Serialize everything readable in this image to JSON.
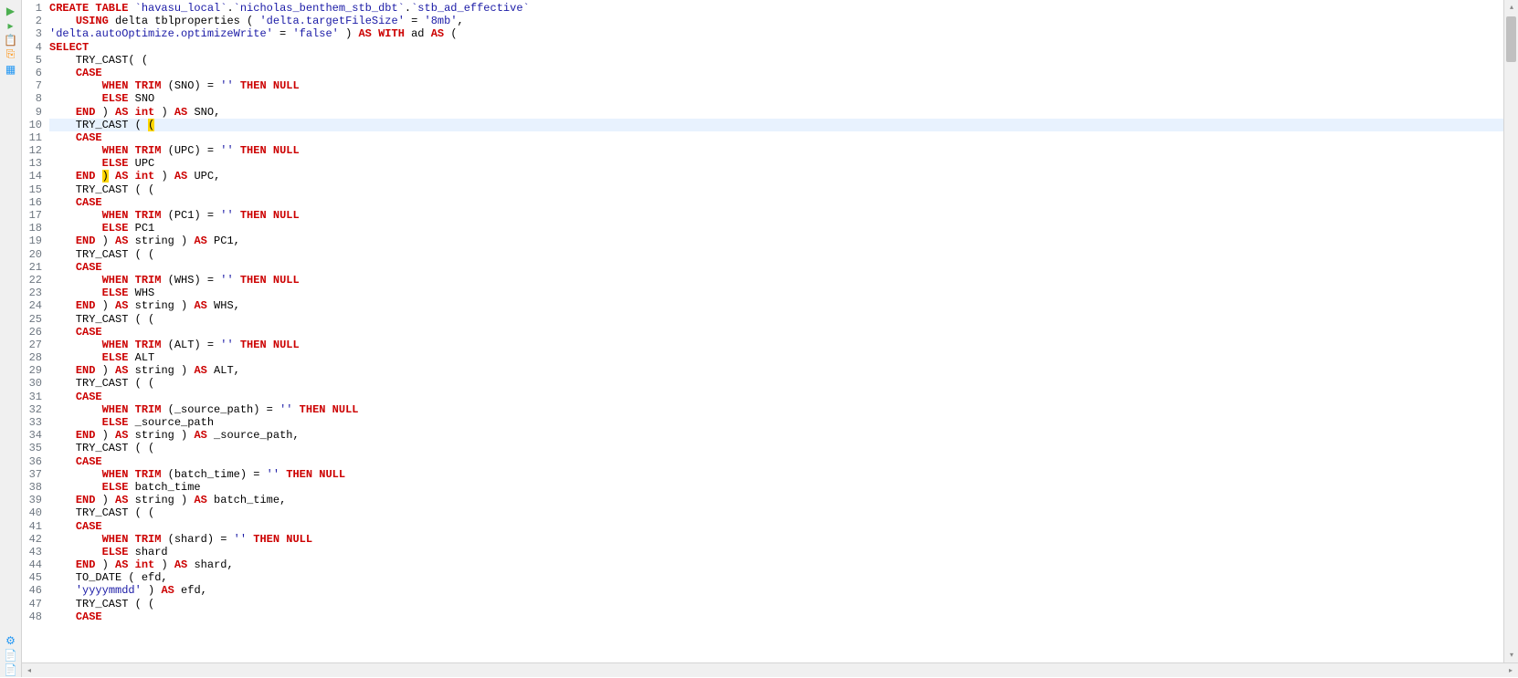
{
  "toolbar": {
    "icons": [
      {
        "name": "run-icon",
        "color": "#4CAF50",
        "glyph": "▶"
      },
      {
        "name": "run-cursor-icon",
        "color": "#4CAF50",
        "glyph": "▸"
      },
      {
        "name": "clipboard-icon",
        "color": "#ff8c00",
        "glyph": "📋"
      },
      {
        "name": "copy-icon",
        "color": "#ff8c00",
        "glyph": "⎘"
      },
      {
        "name": "doc-icon",
        "color": "#2196F3",
        "glyph": "▦"
      }
    ],
    "bottom_icons": [
      {
        "name": "settings-icon",
        "color": "#2196F3",
        "glyph": "⚙"
      },
      {
        "name": "new-doc-icon",
        "color": "#2196F3",
        "glyph": "📄"
      },
      {
        "name": "error-doc-icon",
        "color": "#f44336",
        "glyph": "📄"
      }
    ]
  },
  "code": {
    "lines": [
      {
        "n": 1,
        "tokens": [
          {
            "t": "CREATE TABLE",
            "c": "kw-red"
          },
          {
            "t": " "
          },
          {
            "t": "`havasu_local`",
            "c": "str"
          },
          {
            "t": "."
          },
          {
            "t": "`nicholas_benthem_stb_dbt`",
            "c": "str"
          },
          {
            "t": "."
          },
          {
            "t": "`stb_ad_effective`",
            "c": "str"
          }
        ]
      },
      {
        "n": 2,
        "indent": "    ",
        "tokens": [
          {
            "t": "USING",
            "c": "kw-red"
          },
          {
            "t": " delta tblproperties ( "
          },
          {
            "t": "'delta.targetFileSize'",
            "c": "str"
          },
          {
            "t": " = "
          },
          {
            "t": "'8mb'",
            "c": "str"
          },
          {
            "t": ","
          }
        ]
      },
      {
        "n": 3,
        "tokens": [
          {
            "t": "'delta.autoOptimize.optimizeWrite'",
            "c": "str"
          },
          {
            "t": " = "
          },
          {
            "t": "'false'",
            "c": "str"
          },
          {
            "t": " ) "
          },
          {
            "t": "AS WITH",
            "c": "kw-red"
          },
          {
            "t": " ad "
          },
          {
            "t": "AS",
            "c": "kw-red"
          },
          {
            "t": " ("
          }
        ]
      },
      {
        "n": 4,
        "tokens": [
          {
            "t": "SELECT",
            "c": "kw-red"
          }
        ]
      },
      {
        "n": 5,
        "indent": "    ",
        "tokens": [
          {
            "t": "TRY_CAST( ("
          }
        ]
      },
      {
        "n": 6,
        "indent": "    ",
        "tokens": [
          {
            "t": "CASE",
            "c": "kw-red"
          }
        ]
      },
      {
        "n": 7,
        "indent": "        ",
        "tokens": [
          {
            "t": "WHEN",
            "c": "kw-red"
          },
          {
            "t": " "
          },
          {
            "t": "TRIM",
            "c": "kw-red"
          },
          {
            "t": " (SNO) = "
          },
          {
            "t": "''",
            "c": "str"
          },
          {
            "t": " "
          },
          {
            "t": "THEN NULL",
            "c": "kw-red"
          }
        ]
      },
      {
        "n": 8,
        "indent": "        ",
        "tokens": [
          {
            "t": "ELSE",
            "c": "kw-red"
          },
          {
            "t": " SNO"
          }
        ]
      },
      {
        "n": 9,
        "indent": "    ",
        "tokens": [
          {
            "t": "END",
            "c": "kw-red"
          },
          {
            "t": " ) "
          },
          {
            "t": "AS",
            "c": "kw-red"
          },
          {
            "t": " "
          },
          {
            "t": "int",
            "c": "kw-red"
          },
          {
            "t": " ) "
          },
          {
            "t": "AS",
            "c": "kw-red"
          },
          {
            "t": " SNO,"
          }
        ]
      },
      {
        "n": 10,
        "hl": true,
        "indent": "    ",
        "tokens": [
          {
            "t": "TRY_CAST ( "
          },
          {
            "t": "(",
            "c": "paren-match"
          }
        ]
      },
      {
        "n": 11,
        "indent": "    ",
        "tokens": [
          {
            "t": "CASE",
            "c": "kw-red"
          }
        ]
      },
      {
        "n": 12,
        "indent": "        ",
        "tokens": [
          {
            "t": "WHEN",
            "c": "kw-red"
          },
          {
            "t": " "
          },
          {
            "t": "TRIM",
            "c": "kw-red"
          },
          {
            "t": " (UPC) = "
          },
          {
            "t": "''",
            "c": "str"
          },
          {
            "t": " "
          },
          {
            "t": "THEN NULL",
            "c": "kw-red"
          }
        ]
      },
      {
        "n": 13,
        "indent": "        ",
        "tokens": [
          {
            "t": "ELSE",
            "c": "kw-red"
          },
          {
            "t": " UPC"
          }
        ]
      },
      {
        "n": 14,
        "indent": "    ",
        "tokens": [
          {
            "t": "END",
            "c": "kw-red"
          },
          {
            "t": " "
          },
          {
            "t": ")",
            "c": "paren-match"
          },
          {
            "t": " "
          },
          {
            "t": "AS",
            "c": "kw-red"
          },
          {
            "t": " "
          },
          {
            "t": "int",
            "c": "kw-red"
          },
          {
            "t": " ) "
          },
          {
            "t": "AS",
            "c": "kw-red"
          },
          {
            "t": " UPC,"
          }
        ]
      },
      {
        "n": 15,
        "indent": "    ",
        "tokens": [
          {
            "t": "TRY_CAST ( ("
          }
        ]
      },
      {
        "n": 16,
        "indent": "    ",
        "tokens": [
          {
            "t": "CASE",
            "c": "kw-red"
          }
        ]
      },
      {
        "n": 17,
        "indent": "        ",
        "tokens": [
          {
            "t": "WHEN",
            "c": "kw-red"
          },
          {
            "t": " "
          },
          {
            "t": "TRIM",
            "c": "kw-red"
          },
          {
            "t": " (PC1) = "
          },
          {
            "t": "''",
            "c": "str"
          },
          {
            "t": " "
          },
          {
            "t": "THEN NULL",
            "c": "kw-red"
          }
        ]
      },
      {
        "n": 18,
        "indent": "        ",
        "tokens": [
          {
            "t": "ELSE",
            "c": "kw-red"
          },
          {
            "t": " PC1"
          }
        ]
      },
      {
        "n": 19,
        "indent": "    ",
        "tokens": [
          {
            "t": "END",
            "c": "kw-red"
          },
          {
            "t": " ) "
          },
          {
            "t": "AS",
            "c": "kw-red"
          },
          {
            "t": " string ) "
          },
          {
            "t": "AS",
            "c": "kw-red"
          },
          {
            "t": " PC1,"
          }
        ]
      },
      {
        "n": 20,
        "indent": "    ",
        "tokens": [
          {
            "t": "TRY_CAST ( ("
          }
        ]
      },
      {
        "n": 21,
        "indent": "    ",
        "tokens": [
          {
            "t": "CASE",
            "c": "kw-red"
          }
        ]
      },
      {
        "n": 22,
        "indent": "        ",
        "tokens": [
          {
            "t": "WHEN",
            "c": "kw-red"
          },
          {
            "t": " "
          },
          {
            "t": "TRIM",
            "c": "kw-red"
          },
          {
            "t": " (WHS) = "
          },
          {
            "t": "''",
            "c": "str"
          },
          {
            "t": " "
          },
          {
            "t": "THEN NULL",
            "c": "kw-red"
          }
        ]
      },
      {
        "n": 23,
        "indent": "        ",
        "tokens": [
          {
            "t": "ELSE",
            "c": "kw-red"
          },
          {
            "t": " WHS"
          }
        ]
      },
      {
        "n": 24,
        "indent": "    ",
        "tokens": [
          {
            "t": "END",
            "c": "kw-red"
          },
          {
            "t": " ) "
          },
          {
            "t": "AS",
            "c": "kw-red"
          },
          {
            "t": " string ) "
          },
          {
            "t": "AS",
            "c": "kw-red"
          },
          {
            "t": " WHS,"
          }
        ]
      },
      {
        "n": 25,
        "indent": "    ",
        "tokens": [
          {
            "t": "TRY_CAST ( ("
          }
        ]
      },
      {
        "n": 26,
        "indent": "    ",
        "tokens": [
          {
            "t": "CASE",
            "c": "kw-red"
          }
        ]
      },
      {
        "n": 27,
        "indent": "        ",
        "tokens": [
          {
            "t": "WHEN",
            "c": "kw-red"
          },
          {
            "t": " "
          },
          {
            "t": "TRIM",
            "c": "kw-red"
          },
          {
            "t": " (ALT) = "
          },
          {
            "t": "''",
            "c": "str"
          },
          {
            "t": " "
          },
          {
            "t": "THEN NULL",
            "c": "kw-red"
          }
        ]
      },
      {
        "n": 28,
        "indent": "        ",
        "tokens": [
          {
            "t": "ELSE",
            "c": "kw-red"
          },
          {
            "t": " ALT"
          }
        ]
      },
      {
        "n": 29,
        "indent": "    ",
        "tokens": [
          {
            "t": "END",
            "c": "kw-red"
          },
          {
            "t": " ) "
          },
          {
            "t": "AS",
            "c": "kw-red"
          },
          {
            "t": " string ) "
          },
          {
            "t": "AS",
            "c": "kw-red"
          },
          {
            "t": " ALT,"
          }
        ]
      },
      {
        "n": 30,
        "indent": "    ",
        "tokens": [
          {
            "t": "TRY_CAST ( ("
          }
        ]
      },
      {
        "n": 31,
        "indent": "    ",
        "tokens": [
          {
            "t": "CASE",
            "c": "kw-red"
          }
        ]
      },
      {
        "n": 32,
        "indent": "        ",
        "tokens": [
          {
            "t": "WHEN",
            "c": "kw-red"
          },
          {
            "t": " "
          },
          {
            "t": "TRIM",
            "c": "kw-red"
          },
          {
            "t": " (_source_path) = "
          },
          {
            "t": "''",
            "c": "str"
          },
          {
            "t": " "
          },
          {
            "t": "THEN NULL",
            "c": "kw-red"
          }
        ]
      },
      {
        "n": 33,
        "indent": "        ",
        "tokens": [
          {
            "t": "ELSE",
            "c": "kw-red"
          },
          {
            "t": " _source_path"
          }
        ]
      },
      {
        "n": 34,
        "indent": "    ",
        "tokens": [
          {
            "t": "END",
            "c": "kw-red"
          },
          {
            "t": " ) "
          },
          {
            "t": "AS",
            "c": "kw-red"
          },
          {
            "t": " string ) "
          },
          {
            "t": "AS",
            "c": "kw-red"
          },
          {
            "t": " _source_path,"
          }
        ]
      },
      {
        "n": 35,
        "indent": "    ",
        "tokens": [
          {
            "t": "TRY_CAST ( ("
          }
        ]
      },
      {
        "n": 36,
        "indent": "    ",
        "tokens": [
          {
            "t": "CASE",
            "c": "kw-red"
          }
        ]
      },
      {
        "n": 37,
        "indent": "        ",
        "tokens": [
          {
            "t": "WHEN",
            "c": "kw-red"
          },
          {
            "t": " "
          },
          {
            "t": "TRIM",
            "c": "kw-red"
          },
          {
            "t": " (batch_time) = "
          },
          {
            "t": "''",
            "c": "str"
          },
          {
            "t": " "
          },
          {
            "t": "THEN NULL",
            "c": "kw-red"
          }
        ]
      },
      {
        "n": 38,
        "indent": "        ",
        "tokens": [
          {
            "t": "ELSE",
            "c": "kw-red"
          },
          {
            "t": " batch_time"
          }
        ]
      },
      {
        "n": 39,
        "indent": "    ",
        "tokens": [
          {
            "t": "END",
            "c": "kw-red"
          },
          {
            "t": " ) "
          },
          {
            "t": "AS",
            "c": "kw-red"
          },
          {
            "t": " string ) "
          },
          {
            "t": "AS",
            "c": "kw-red"
          },
          {
            "t": " batch_time,"
          }
        ]
      },
      {
        "n": 40,
        "indent": "    ",
        "tokens": [
          {
            "t": "TRY_CAST ( ("
          }
        ]
      },
      {
        "n": 41,
        "indent": "    ",
        "tokens": [
          {
            "t": "CASE",
            "c": "kw-red"
          }
        ]
      },
      {
        "n": 42,
        "indent": "        ",
        "tokens": [
          {
            "t": "WHEN",
            "c": "kw-red"
          },
          {
            "t": " "
          },
          {
            "t": "TRIM",
            "c": "kw-red"
          },
          {
            "t": " (shard) = "
          },
          {
            "t": "''",
            "c": "str"
          },
          {
            "t": " "
          },
          {
            "t": "THEN NULL",
            "c": "kw-red"
          }
        ]
      },
      {
        "n": 43,
        "indent": "        ",
        "tokens": [
          {
            "t": "ELSE",
            "c": "kw-red"
          },
          {
            "t": " shard"
          }
        ]
      },
      {
        "n": 44,
        "indent": "    ",
        "tokens": [
          {
            "t": "END",
            "c": "kw-red"
          },
          {
            "t": " ) "
          },
          {
            "t": "AS",
            "c": "kw-red"
          },
          {
            "t": " "
          },
          {
            "t": "int",
            "c": "kw-red"
          },
          {
            "t": " ) "
          },
          {
            "t": "AS",
            "c": "kw-red"
          },
          {
            "t": " shard,"
          }
        ]
      },
      {
        "n": 45,
        "indent": "    ",
        "tokens": [
          {
            "t": "TO_DATE ( efd,"
          }
        ]
      },
      {
        "n": 46,
        "indent": "    ",
        "tokens": [
          {
            "t": "'yyyymmdd'",
            "c": "str"
          },
          {
            "t": " ) "
          },
          {
            "t": "AS",
            "c": "kw-red"
          },
          {
            "t": " efd,"
          }
        ]
      },
      {
        "n": 47,
        "indent": "    ",
        "tokens": [
          {
            "t": "TRY_CAST ( ("
          }
        ]
      },
      {
        "n": 48,
        "indent": "    ",
        "tokens": [
          {
            "t": "CASE",
            "c": "kw-red"
          }
        ]
      }
    ]
  }
}
